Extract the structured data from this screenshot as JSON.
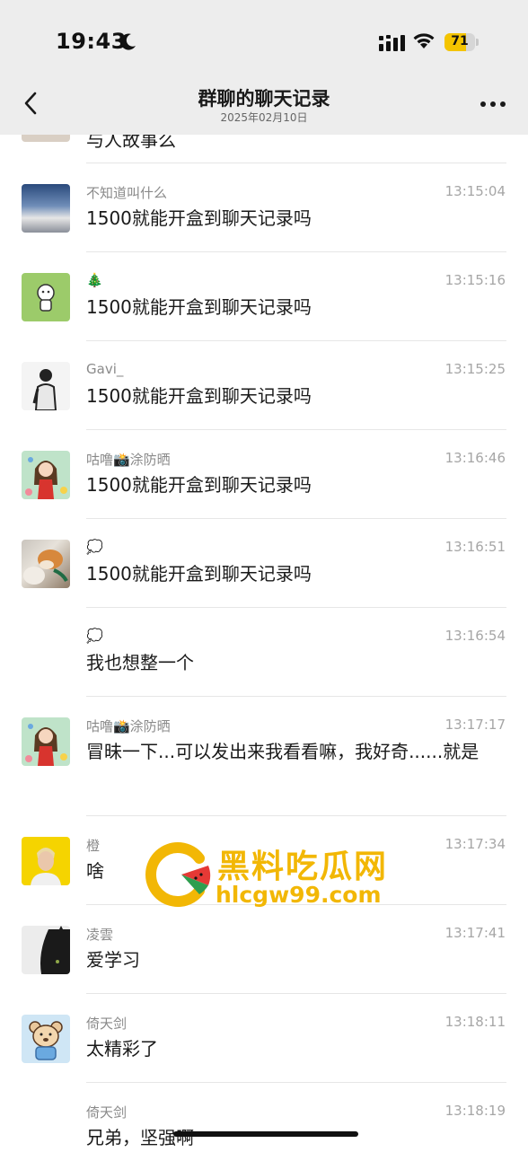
{
  "status": {
    "time": "19:43",
    "battery": "71",
    "battery_level": 0.71
  },
  "nav": {
    "title": "群聊的聊天记录",
    "subtitle": "2025年02月10日"
  },
  "partial_message": "与人故事么",
  "messages": [
    {
      "name": "不知道叫什么",
      "time": "13:15:04",
      "text": "1500就能开盒到聊天记录吗",
      "avatar": "clouds-avatar"
    },
    {
      "name": "🎄",
      "time": "13:15:16",
      "text": "1500就能开盒到聊天记录吗",
      "avatar": "cartoon-green-avatar"
    },
    {
      "name": "Gavi_",
      "time": "13:15:25",
      "text": "1500就能开盒到聊天记录吗",
      "avatar": "bw-person-avatar"
    },
    {
      "name": "咕噜📸涂防晒",
      "time": "13:16:46",
      "text": "1500就能开盒到聊天记录吗",
      "avatar": "cartoon-girl-avatar"
    },
    {
      "name": "💭",
      "time": "13:16:51",
      "text": "1500就能开盒到聊天记录吗",
      "avatar": "shiba-dog-avatar"
    },
    {
      "name": "💭",
      "time": "13:16:54",
      "text": "我也想整一个",
      "avatar": ""
    },
    {
      "name": "咕噜📸涂防晒",
      "time": "13:17:17",
      "text": "冒昧一下...可以发出来我看看嘛，我好奇......就是",
      "avatar": "cartoon-girl-avatar"
    },
    {
      "name": "橙",
      "time": "13:17:34",
      "text": "啥",
      "avatar": "yellow-portrait-avatar"
    },
    {
      "name": "凌雲",
      "time": "13:17:41",
      "text": "爱学习",
      "avatar": "black-cat-avatar"
    },
    {
      "name": "倚天剑",
      "time": "13:18:11",
      "text": "太精彩了",
      "avatar": "bear-avatar"
    },
    {
      "name": "倚天剑",
      "time": "13:18:19",
      "text": "兄弟，坚强啊",
      "avatar": ""
    }
  ],
  "watermark": {
    "cn": "黑料吃瓜网",
    "url": "hlcgw99.com"
  },
  "colors": {
    "topbar": "#ededed",
    "accent": "#f2b705",
    "battery": "#f4c400"
  }
}
